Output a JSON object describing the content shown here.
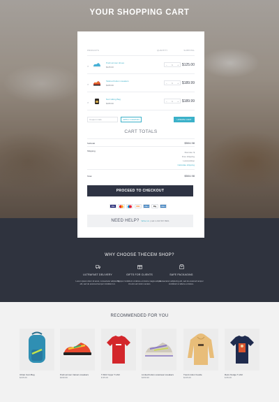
{
  "page_title": "YOUR SHOPPING CART",
  "cart": {
    "columns": [
      "Products",
      "Quantity",
      "Subtotal"
    ],
    "items": [
      {
        "name": "Push armour shoes",
        "price": "$125.00",
        "qty": "1",
        "subtotal": "$125.00",
        "thumb_color": "#46b0d6"
      },
      {
        "name": "Tailored button sneakers",
        "price": "$189.99",
        "qty": "1",
        "subtotal": "$189.99",
        "thumb_color": "#d9482f"
      },
      {
        "name": "Noir Hiking Bag",
        "price": "$189.99",
        "qty": "1",
        "subtotal": "$189.99",
        "thumb_color": "#2f2a24"
      }
    ],
    "coupon_placeholder": "Coupon code",
    "apply_label": "Apply coupon",
    "update_label": "Update cart",
    "totals_title": "Cart Totals",
    "subtotal_label": "Subtotal",
    "subtotal_value": "$504.98",
    "shipping_label": "Shipping",
    "shipping_lines": [
      "Flat rate: $",
      "Free shipping",
      "Local pickup"
    ],
    "shipping_link": "Calculate shipping",
    "total_label": "Total",
    "total_value": "$504.98",
    "checkout_label": "Proceed to checkout",
    "payments": [
      {
        "name": "VISA",
        "color": "#1a1f71",
        "text": "#ffffff"
      },
      {
        "name": "MC",
        "color": "#ffffff",
        "text": "#eb001b"
      },
      {
        "name": "MAES",
        "color": "#ffffff",
        "text": "#0099df"
      },
      {
        "name": "DISC",
        "color": "#ffffff",
        "text": "#f58220"
      },
      {
        "name": "AMEX",
        "color": "#2e77bb",
        "text": "#ffffff"
      },
      {
        "name": "Pay",
        "color": "#ffffff",
        "text": "#000000"
      },
      {
        "name": "AMEX",
        "color": "#2e77bb",
        "text": "#ffffff"
      }
    ],
    "help_big": "NEED HELP?",
    "help_link": "Write Us",
    "help_phone": "call 1 234 567 8901"
  },
  "why": {
    "title": "Why choose TheCem shop?",
    "features": [
      {
        "title": "Ultrafast delivery",
        "desc": "Lorem ipsum dolor sit amet, consectetur adipiscing elit, sed do eiusmod tempor incididunt ut.",
        "icon": "truck-icon"
      },
      {
        "title": "Gifts for clients",
        "desc": "Tempor incididunt ut labore et dolore magna aliqua. Ut enim ad minim veniam.",
        "icon": "gift-icon"
      },
      {
        "title": "Safe packaging",
        "desc": "Consectetur adipiscing elit, sed do eiusmod tempor incididunt ut labore et dolore.",
        "icon": "box-icon"
      }
    ]
  },
  "recommended": {
    "title": "Recommended for you",
    "products": [
      {
        "name": "Urban Cam Bag",
        "price": "$135.00",
        "kind": "backpack"
      },
      {
        "name": "Push armour trainers sneakers",
        "price": "$199.99",
        "kind": "sneaker"
      },
      {
        "name": "T-Shirt 'Hype' T-shirt",
        "price": "$ 95.00",
        "kind": "tshirt-red"
      },
      {
        "name": "Limited button outerwear sneakers",
        "price": "$159.99",
        "kind": "sneaker2"
      },
      {
        "name": "Trend cotton hoodie",
        "price": "$135.00",
        "kind": "hoodie"
      },
      {
        "name": "Retro Nudge T-shirt",
        "price": "$ 89.00",
        "kind": "tshirt-navy"
      }
    ]
  }
}
